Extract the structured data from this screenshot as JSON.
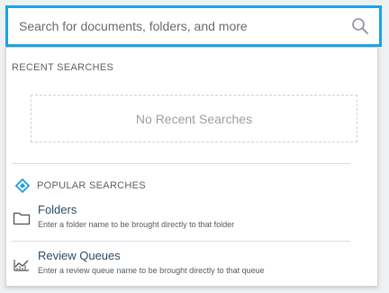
{
  "search": {
    "placeholder": "Search for documents, folders, and more",
    "value": "",
    "accent_color": "#1aa3e8"
  },
  "recent": {
    "title": "RECENT SEARCHES",
    "empty_text": "No Recent Searches"
  },
  "popular": {
    "title": "POPULAR SEARCHES",
    "icon": "diamond-icon",
    "icon_color": "#1a9fd8",
    "items": [
      {
        "icon": "folder-icon",
        "title": "Folders",
        "description": "Enter a folder name to be brought directly to that folder"
      },
      {
        "icon": "review-queue-icon",
        "title": "Review Queues",
        "description": "Enter a review queue name to be brought directly to that queue"
      }
    ]
  }
}
